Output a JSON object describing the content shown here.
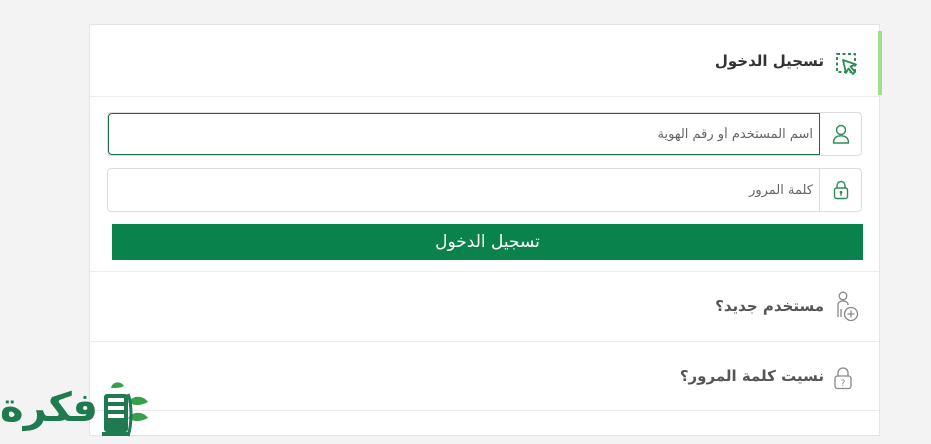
{
  "header": {
    "title": "تسجيل الدخول",
    "icon": "cursor-select-icon"
  },
  "form": {
    "username": {
      "placeholder": "اسم المستخدم أو رقم الهوية",
      "value": "",
      "icon": "user-icon"
    },
    "password": {
      "placeholder": "كلمة المرور",
      "value": "",
      "icon": "lock-icon"
    },
    "submit_label": "تسجيل الدخول"
  },
  "links": {
    "new_user": {
      "label": "مستخدم جديد؟",
      "icon": "add-user-icon"
    },
    "forgot_password": {
      "label": "نسيت كلمة المرور؟",
      "icon": "lock-question-icon"
    }
  },
  "logo": {
    "text": "فكرة"
  },
  "colors": {
    "primary": "#09824b",
    "accent": "#9fe08a",
    "focus_border": "#1d6b47",
    "icon_green": "#2e8b57"
  }
}
